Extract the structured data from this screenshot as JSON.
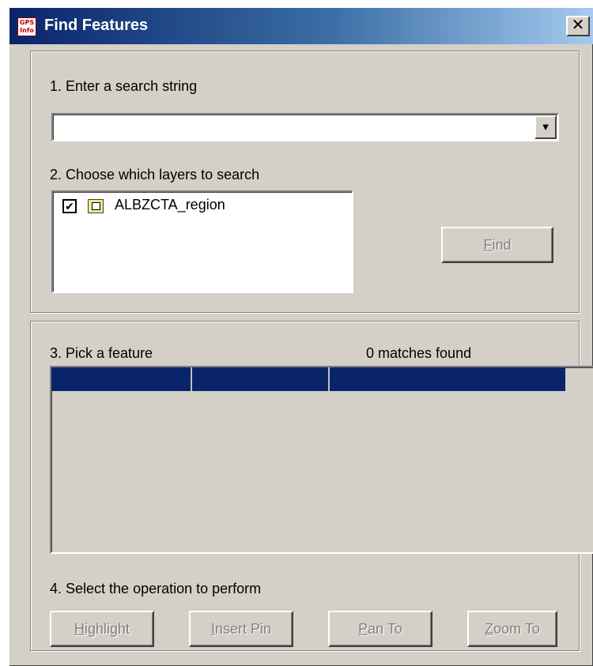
{
  "window": {
    "title": "Find Features",
    "app_icon_text_line1": "GPS",
    "app_icon_text_line2": "Info",
    "close_glyph": "✕"
  },
  "step1": {
    "label": "1. Enter a search string",
    "input_value": "",
    "dropdown_glyph": "▼"
  },
  "step2": {
    "label": "2. Choose which layers to search",
    "layers": [
      {
        "name": "ALBZCTA_region",
        "checked": true,
        "check_glyph": "✔",
        "icon": "region-layer-icon"
      }
    ],
    "find_button": {
      "mnemonic": "F",
      "rest": "ind",
      "enabled": false
    }
  },
  "step3": {
    "label": "3. Pick a feature",
    "match_count": "0 matches found",
    "columns": [
      "",
      "",
      ""
    ]
  },
  "step4": {
    "label": "4. Select the operation to perform",
    "buttons": [
      {
        "mnemonic": "H",
        "rest": "ighlight",
        "enabled": false
      },
      {
        "mnemonic": "I",
        "rest": "nsert Pin",
        "enabled": false
      },
      {
        "mnemonic": "P",
        "rest": "an To",
        "enabled": false
      },
      {
        "mnemonic": "Z",
        "rest": "oom To",
        "enabled": false
      }
    ]
  },
  "colors": {
    "titlebar_start": "#0a246a",
    "titlebar_end": "#a6caf0",
    "face": "#d4d0c8",
    "selected_header": "#0a246a",
    "disabled_text": "#808080"
  }
}
